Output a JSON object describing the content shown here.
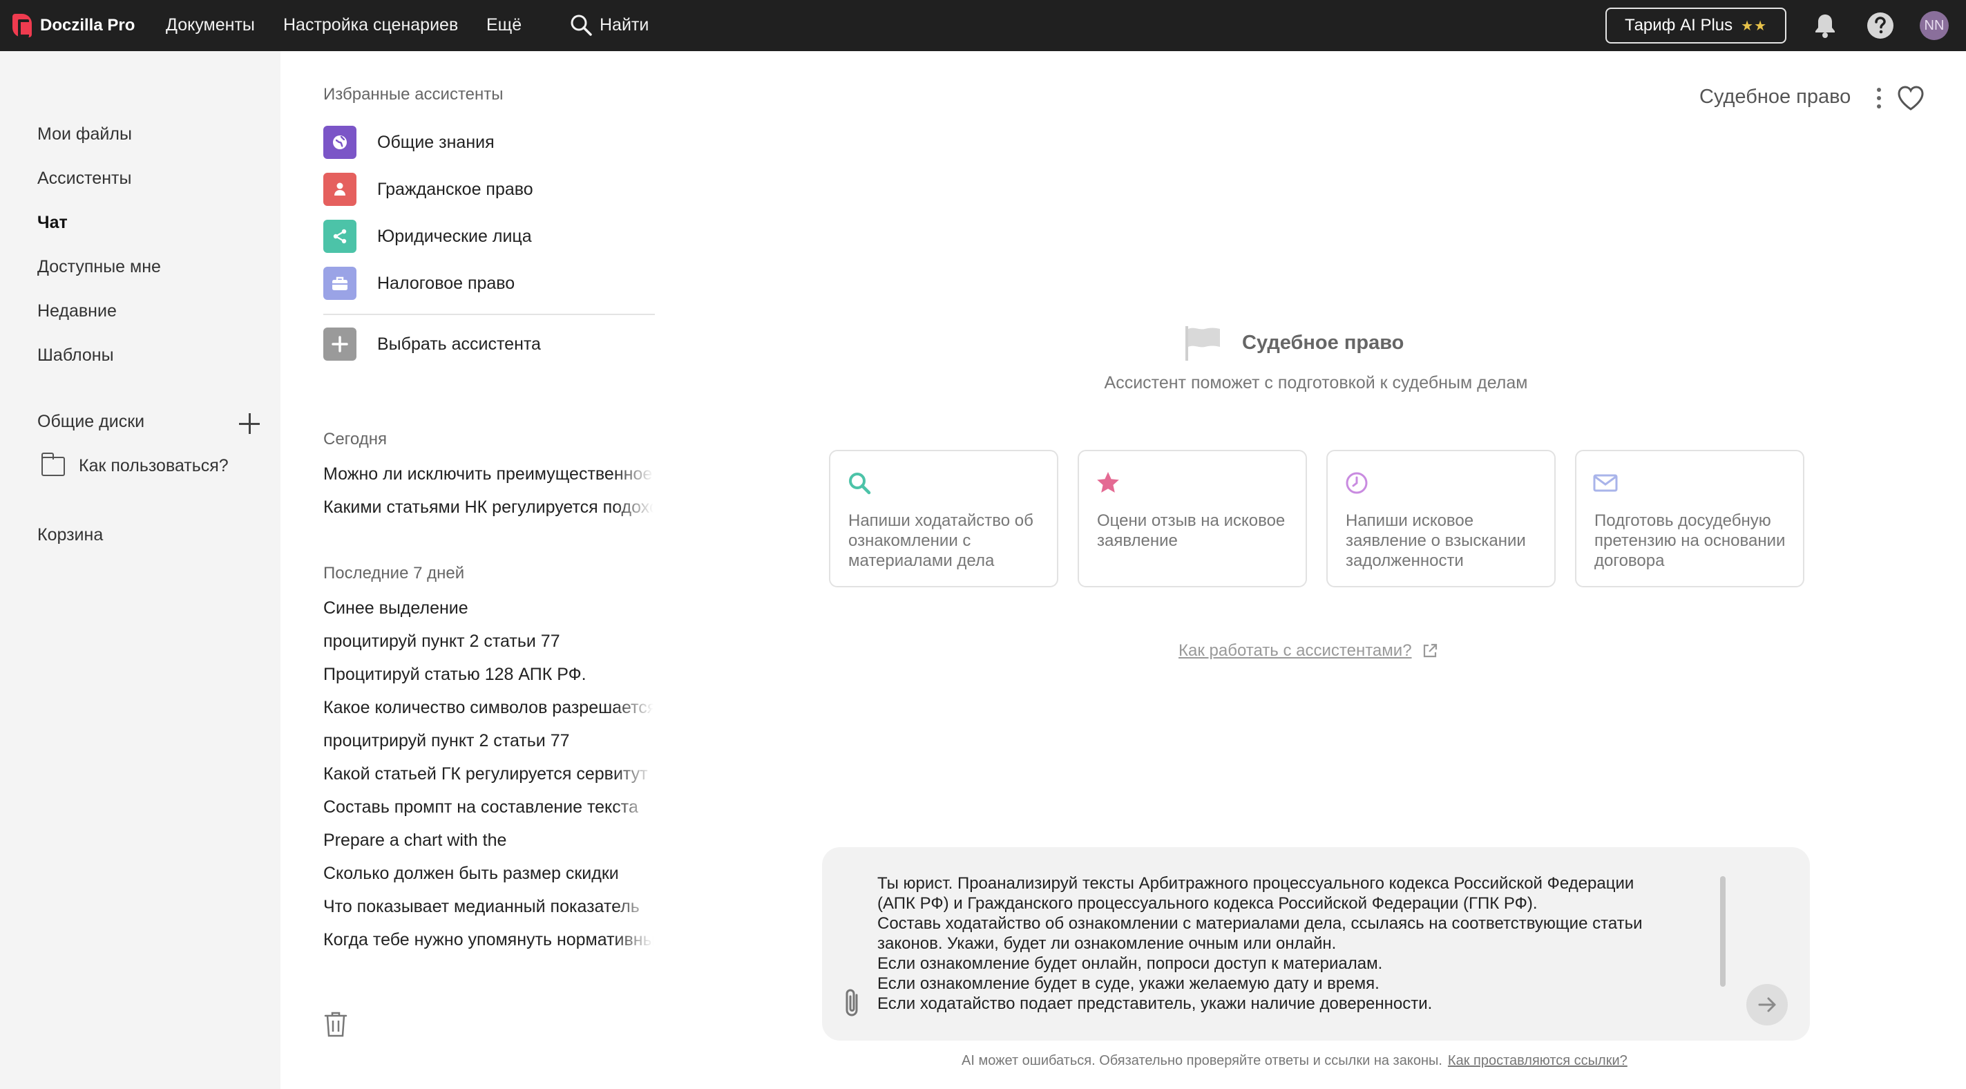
{
  "topbar": {
    "app_name": "Doczilla Pro",
    "nav": [
      "Документы",
      "Настройка сценариев",
      "Ещё"
    ],
    "search_label": "Найти",
    "tariff_label": "Тариф AI Plus",
    "tariff_stars": "★★",
    "avatar_initials": "NN"
  },
  "sidebar": {
    "items": [
      "Мои файлы",
      "Ассистенты",
      "Чат",
      "Доступные мне",
      "Недавние",
      "Шаблоны"
    ],
    "active_item": "Чат",
    "shared_disks_label": "Общие диски",
    "folder_label": "Как пользоваться?",
    "trash_label": "Корзина"
  },
  "panel": {
    "favorites_label": "Избранные ассистенты",
    "favorites": [
      {
        "label": "Общие знания",
        "icon": "globe-icon",
        "color": "#7b55c7"
      },
      {
        "label": "Гражданское право",
        "icon": "person-icon",
        "color": "#e5605e"
      },
      {
        "label": "Юридические лица",
        "icon": "share-icon",
        "color": "#4cc3a8"
      },
      {
        "label": "Налоговое право",
        "icon": "briefcase-icon",
        "color": "#9aa3e6"
      }
    ],
    "choose_label": "Выбрать ассистента",
    "today_label": "Сегодня",
    "today": [
      "Можно ли исключить преимущественное",
      "Какими статьями НК регулируется подоходный"
    ],
    "week_label": "Последние 7 дней",
    "week": [
      "Синее выделение",
      "процитируй пункт 2 статьи 77",
      "Процитируй статью 128 АПК РФ.",
      "Какое количество символов разрешается",
      "процитрируй пункт 2 статьи 77",
      "Какой статьей ГК регулируется сервитут",
      "Составь промпт на составление текста",
      "Prepare a chart with the",
      "Сколько должен быть размер скидки",
      "Что показывает медианный показатель",
      "Когда тебе нужно упомянуть нормативный"
    ]
  },
  "main": {
    "title": "Судебное право",
    "hero_title": "Судебное право",
    "hero_subtitle": "Ассистент поможет с подготовкой к судебным делам",
    "cards": [
      {
        "text": "Напиши ходатайство об ознакомлении с материалами дела",
        "icon": "search-icon",
        "color": "#4cc3a8"
      },
      {
        "text": "Оцени отзыв на исковое заявление",
        "icon": "star-icon",
        "color": "#e46a93"
      },
      {
        "text": "Напиши исковое заявление о взыскании задолженности",
        "icon": "clock-icon",
        "color": "#c98be0"
      },
      {
        "text": "Подготовь досудебную претензию на основании договора",
        "icon": "mail-icon",
        "color": "#a9b4ea"
      }
    ],
    "help_link": "Как работать с ассистентами?",
    "input_text": "Ты юрист. Проанализируй тексты Арбитражного процессуального кодекса Российской Федерации\n(АПК РФ) и Гражданского процессуального кодекса Российской Федерации (ГПК РФ).\nСоставь ходатайство об ознакомлении с материалами дела, ссылаясь на соответствующие статьи\nзаконов. Укажи, будет ли ознакомление очным или онлайн.\nЕсли ознакомление будет онлайн, попроси доступ к материалам.\nЕсли ознакомление будет в суде, укажи желаемую дату и время.\nЕсли ходатайство подает представитель, укажи наличие доверенности.",
    "disclaimer": "AI может ошибаться. Обязательно проверяйте ответы и ссылки на законы.",
    "disclaimer_link": "Как проставляются ссылки?"
  }
}
